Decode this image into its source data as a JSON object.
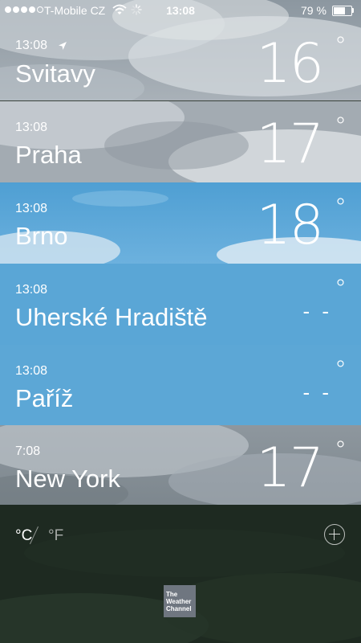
{
  "status_bar": {
    "signal_bars_filled": 4,
    "signal_bars_total": 5,
    "carrier": "T-Mobile CZ",
    "wifi_icon": "wifi-icon",
    "activity_icon": "loading-spinner-icon",
    "time": "13:08",
    "battery_percent": "79 %",
    "battery_level": 0.79
  },
  "cities": [
    {
      "time": "13:08",
      "name": "Svitavy",
      "temp": "16",
      "degree": "°",
      "current_location": true,
      "location_icon": "location-arrow-icon"
    },
    {
      "time": "13:08",
      "name": "Praha",
      "temp": "17",
      "degree": "°"
    },
    {
      "time": "13:08",
      "name": "Brno",
      "temp": "18",
      "degree": "°"
    },
    {
      "time": "13:08",
      "name": "Uherské Hradiště",
      "temp": "- -",
      "degree": "°"
    },
    {
      "time": "13:08",
      "name": "Paříž",
      "temp": "- -",
      "degree": "°"
    },
    {
      "time": "7:08",
      "name": "New York",
      "temp": "17",
      "degree": "°"
    }
  ],
  "bottom_bar": {
    "celsius_label": "°C",
    "fahrenheit_label": "°F",
    "selected_unit": "C",
    "add_icon": "add-circle-icon",
    "logo_lines": [
      "The",
      "Weather",
      "Channel"
    ]
  },
  "colors": {
    "sky_blue": "#5aa6d6",
    "cloud_gray": "#9aa3ab",
    "bottom_dark": "#1f2c22"
  }
}
